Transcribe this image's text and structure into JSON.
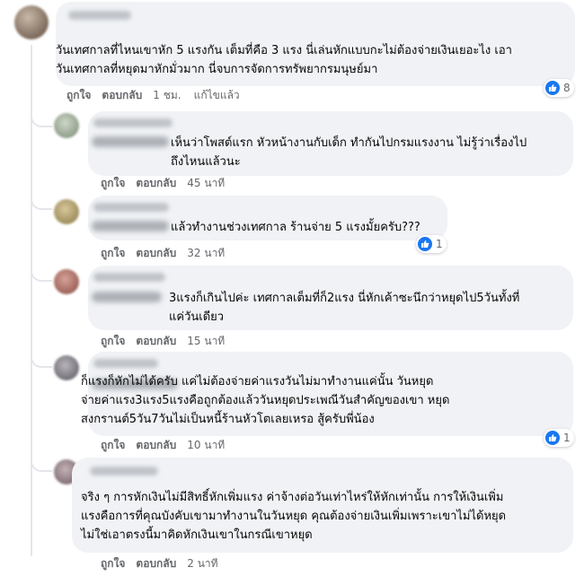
{
  "colors": {
    "bubble": "#f0f2f5",
    "meta": "#65676b",
    "like": "#1877f2",
    "line": "#e4e6eb"
  },
  "icons": {
    "reaction": "like-icon"
  },
  "comments": [
    {
      "text": "วันเทศกาลที่ไหนเขาหัก 5 แรงกัน เต็มที่คือ 3 แรง นี่เล่นหักแบบกะไม่ต้องจ่ายเงินเยอะไง เอา\nวันเทศกาลที่หยุดมาหักมั่วมาก นี่จบการจัดการทรัพยากรมนุษย์มา",
      "like": "ถูกใจ",
      "reply": "ตอบกลับ",
      "time": "1 ชม.",
      "edited": "แก้ไขแล้ว",
      "reactions": "8"
    },
    {
      "text": "เห็นว่าโพสต์แรก หัวหน้างานกับเด็ก ทำกันไปกรมแรงงาน ไม่รู้ว่าเรื่องไป\nถึงไหนแล้วนะ",
      "like": "ถูกใจ",
      "reply": "ตอบกลับ",
      "time": "45 นาที"
    },
    {
      "text": "แล้วทำงานช่วงเทศกาล ร้านจ่าย 5 แรงมั้ยครับ???",
      "like": "ถูกใจ",
      "reply": "ตอบกลับ",
      "time": "32 นาที",
      "reactions": "1"
    },
    {
      "text": "3แรงก็เกินไปค่ะ เทศกาลเต็มที่ก็2แรง นี่หักเค้าซะนึกว่าหยุดไป5วันทั้งที่\nแค่วันเดียว",
      "like": "ถูกใจ",
      "reply": "ตอบกลับ",
      "time": "15 นาที"
    },
    {
      "text": "ก็แรงก็หักไม่ได้ครับ แค่ไม่ต้องจ่ายค่าแรงวันไม่มาทำงานแค่นั้น วันหยุด\nจ่ายค่าแรง3แรง5แรงคือถูกต้องแล้ววันหยุดประเพณีวันสำคัญของเขา หยุด\nสงกรานต์5วัน7วันไม่เป็นหนี้ร้านหัวโตเลยเหรอ สู้ครับพี่น้อง",
      "like": "ถูกใจ",
      "reply": "ตอบกลับ",
      "time": "10 นาที",
      "reactions": "1"
    },
    {
      "text": "จริง ๆ การหักเงินไม่มีสิทธิ์หักเพิ่มแรง ค่าจ้างต่อวันเท่าไหร่ให้หักเท่านั้น การให้เงินเพิ่ม\nแรงคือการที่คุณบังคับเขามาทำงานในวันหยุด คุณต้องจ่ายเงินเพิ่มเพราะเขาไม่ได้หยุด\nไม่ใช่เอาตรงนี้มาคิดหักเงินเขาในกรณีเขาหยุด",
      "like": "ถูกใจ",
      "reply": "ตอบกลับ",
      "time": "2 นาที"
    }
  ]
}
